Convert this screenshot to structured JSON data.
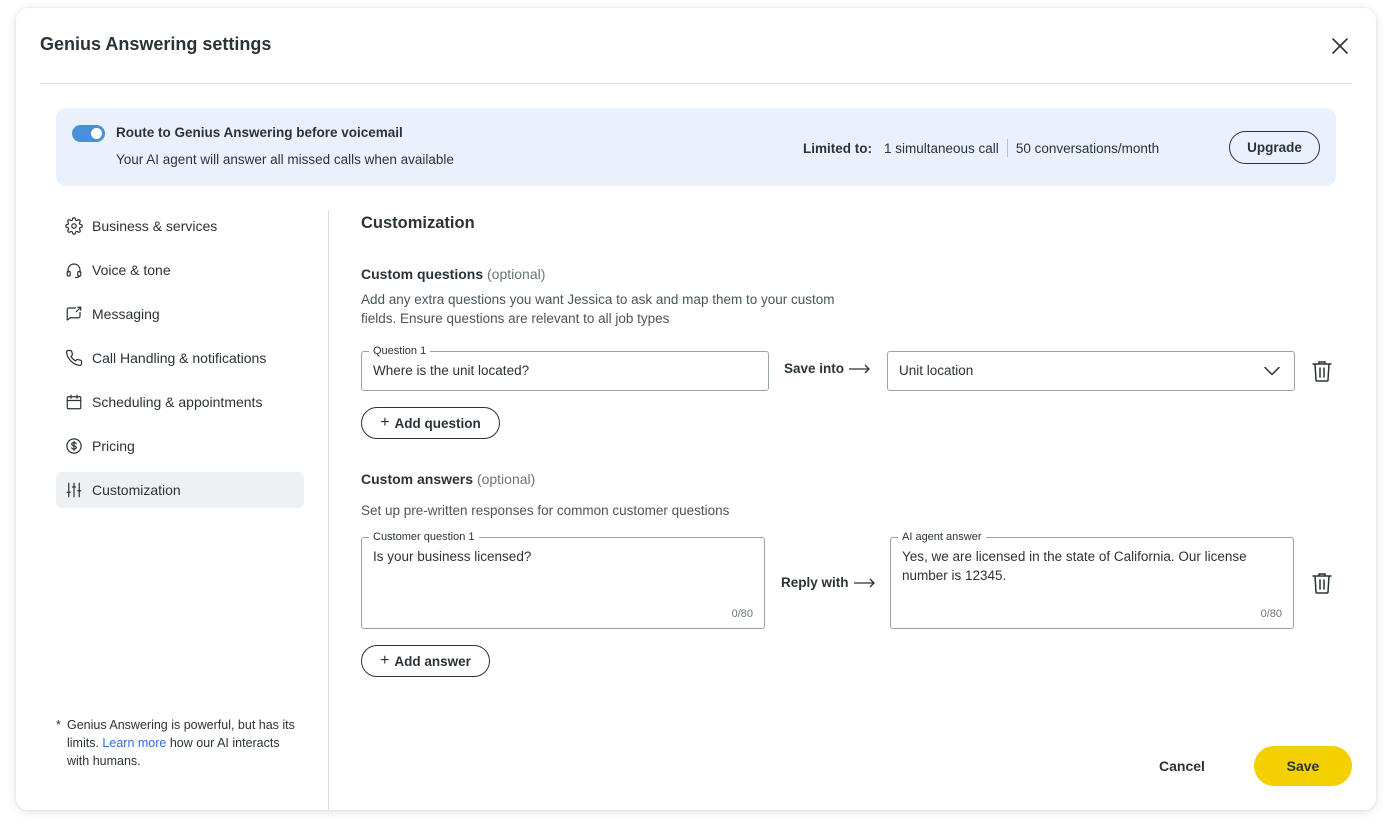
{
  "modal": {
    "title": "Genius Answering settings"
  },
  "banner": {
    "toggle_on": true,
    "title": "Route to Genius Answering before voicemail",
    "subtitle": "Your AI agent will answer all missed calls when available",
    "limits_label": "Limited to:",
    "limit_calls": "1 simultaneous call",
    "limit_conversations": "50 conversations/month",
    "upgrade_label": "Upgrade"
  },
  "sidebar": {
    "items": [
      {
        "label": "Business & services",
        "icon": "gear-icon"
      },
      {
        "label": "Voice & tone",
        "icon": "headset-icon"
      },
      {
        "label": "Messaging",
        "icon": "message-icon"
      },
      {
        "label": "Call Handling & notifications",
        "icon": "phone-icon"
      },
      {
        "label": "Scheduling & appointments",
        "icon": "calendar-icon"
      },
      {
        "label": "Pricing",
        "icon": "dollar-icon"
      },
      {
        "label": "Customization",
        "icon": "sliders-icon",
        "active": true
      }
    ],
    "footnote_star": "*",
    "footnote_pre": "Genius Answering is powerful, but has its limits. ",
    "footnote_link": "Learn more",
    "footnote_post": " how our AI interacts with humans."
  },
  "customization": {
    "title": "Customization",
    "questions": {
      "title": "Custom questions",
      "optional": "(optional)",
      "description": "Add any extra questions you want Jessica to ask and map them to your custom fields. Ensure questions are relevant to all job types",
      "question_label": "Question 1",
      "question_value": "Where is the unit located?",
      "save_into_label": "Save into",
      "field_value": "Unit location",
      "add_label": "Add question"
    },
    "answers": {
      "title": "Custom answers",
      "optional": "(optional)",
      "description": "Set up pre-written responses for common customer questions",
      "question_label": "Customer question 1",
      "question_value": "Is your business licensed?",
      "question_counter": "0/80",
      "reply_with_label": "Reply with",
      "answer_label": "AI agent answer",
      "answer_value": "Yes, we are licensed in the state of California. Our license number is 12345.",
      "answer_counter": "0/80",
      "add_label": "Add answer"
    }
  },
  "footer": {
    "cancel_label": "Cancel",
    "save_label": "Save"
  },
  "colors": {
    "accent_yellow": "#f5d000",
    "banner_bg": "#e9f2fc",
    "toggle_blue": "#4a90d9",
    "link_blue": "#2b6fd6"
  }
}
